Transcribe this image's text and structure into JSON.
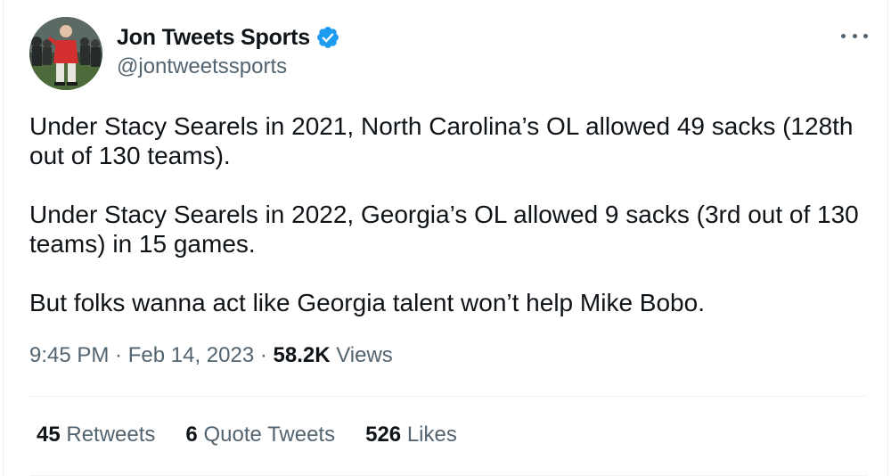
{
  "author": {
    "display_name": "Jon Tweets Sports",
    "handle": "@jontweetssports",
    "verified": true,
    "avatar": "profile-photo-golfer-red-jacket"
  },
  "tweet": {
    "paragraphs": [
      "Under Stacy Searels in 2021, North Carolina’s OL allowed 49 sacks (128th out of 130 teams).",
      "Under Stacy Searels in 2022, Georgia’s OL allowed 9 sacks (3rd out of 130 teams) in 15 games.",
      "But folks wanna act like Georgia talent won’t help Mike Bobo."
    ]
  },
  "meta": {
    "time": "9:45 PM",
    "separator": " · ",
    "date": "Feb 14, 2023",
    "views_count": "58.2K",
    "views_label": "Views"
  },
  "stats": [
    {
      "count": "45",
      "label": "Retweets"
    },
    {
      "count": "6",
      "label": "Quote Tweets"
    },
    {
      "count": "526",
      "label": "Likes"
    }
  ],
  "icons": {
    "verified": "verified-badge-icon",
    "more": "more-options-icon"
  },
  "colors": {
    "text_primary": "#0f1419",
    "text_secondary": "#536471",
    "verified_blue": "#1d9bf0",
    "divider": "#eff3f4"
  }
}
